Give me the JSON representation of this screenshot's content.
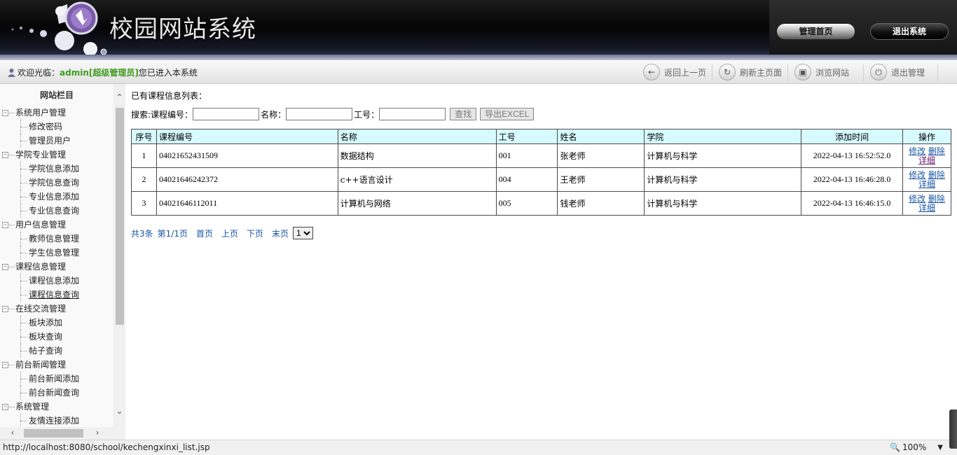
{
  "header": {
    "site_title": "校园网站系统",
    "home_button": "管理首页",
    "logout_button": "退出系统"
  },
  "toolbar": {
    "welcome_prefix": "欢迎光临：",
    "username": "admin[超级管理员]",
    "welcome_suffix": " 您已进入本系统",
    "back": "返回上一页",
    "refresh": "刷新主页面",
    "browse": "浏览网站",
    "exit": "退出管理"
  },
  "sidebar": {
    "title": "网站栏目",
    "groups": [
      {
        "label": "系统用户管理",
        "items": [
          "修改密码",
          "管理员用户"
        ]
      },
      {
        "label": "学院专业管理",
        "items": [
          "学院信息添加",
          "学院信息查询",
          "专业信息添加",
          "专业信息查询"
        ]
      },
      {
        "label": "用户信息管理",
        "items": [
          "教师信息管理",
          "学生信息管理"
        ]
      },
      {
        "label": "课程信息管理",
        "items": [
          "课程信息添加",
          "课程信息查询"
        ]
      },
      {
        "label": "在线交流管理",
        "items": [
          "板块添加",
          "板块查询",
          "帖子查询"
        ]
      },
      {
        "label": "前台新闻管理",
        "items": [
          "前台新闻添加",
          "前台新闻查询"
        ]
      },
      {
        "label": "系统管理",
        "items": [
          "友情连接添加"
        ]
      }
    ],
    "active_item": "课程信息查询"
  },
  "main": {
    "list_title": "已有课程信息列表：",
    "search": {
      "prefix": "搜索:",
      "code_label": "课程编号：",
      "name_label": "名称：",
      "id_label": "工号：",
      "search_button": "查找",
      "export_button": "导出EXCEL",
      "code_value": "",
      "name_value": "",
      "id_value": ""
    },
    "table": {
      "headers": [
        "序号",
        "课程编号",
        "名称",
        "工号",
        "姓名",
        "学院",
        "添加时间",
        "操作"
      ],
      "rows": [
        {
          "no": "1",
          "code": "04021652431509",
          "name": "数据结构",
          "work_id": "001",
          "teacher": "张老师",
          "college": "计算机与科学",
          "time": "2022-04-13 16:52:52.0"
        },
        {
          "no": "2",
          "code": "04021646242372",
          "name": "c++语言设计",
          "work_id": "004",
          "teacher": "王老师",
          "college": "计算机与科学",
          "time": "2022-04-13 16:46:28.0"
        },
        {
          "no": "3",
          "code": "04021646112011",
          "name": "计算机与网络",
          "work_id": "005",
          "teacher": "钱老师",
          "college": "计算机与科学",
          "time": "2022-04-13 16:46:15.0"
        }
      ],
      "op_edit": "修改",
      "op_delete": "删除",
      "op_detail": "详细"
    },
    "pager": {
      "total": "共3条",
      "page_info": "第1/1页",
      "first": "首页",
      "prev": "上页",
      "next": "下页",
      "last": "末页",
      "selected_page": "1"
    }
  },
  "statusbar": {
    "url": "http://localhost:8080/school/kechengxinxi_list.jsp",
    "zoom": "100%"
  },
  "colors": {
    "table_header_bg": "#d6fafe",
    "link": "#1a55a5",
    "admin_green": "#3f9b21"
  }
}
